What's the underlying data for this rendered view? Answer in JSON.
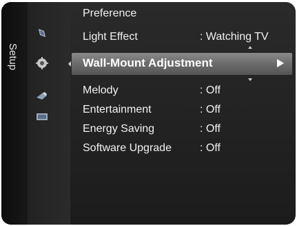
{
  "sidebar": {
    "label": "Setup"
  },
  "icons": [
    "picture-icon",
    "gear-icon",
    "satellite-icon",
    "input-icon"
  ],
  "menu": {
    "title": "Preference",
    "items_before": [
      {
        "label": "Light Effect",
        "value": ": Watching TV"
      }
    ],
    "selected": {
      "label": "Wall-Mount Adjustment"
    },
    "items_after": [
      {
        "label": "Melody",
        "value": ": Off"
      },
      {
        "label": "Entertainment",
        "value": ": Off"
      },
      {
        "label": "Energy Saving",
        "value": ": Off"
      },
      {
        "label": "Software Upgrade",
        "value": ": Off"
      }
    ]
  },
  "colors": {
    "highlight": "#6e6e6e",
    "text": "#f2f2f2",
    "background": "#222222"
  }
}
